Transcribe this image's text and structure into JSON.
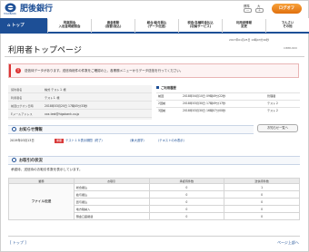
{
  "header": {
    "bank_name": "肥後銀行",
    "bank_sub": "HIGOBANK",
    "font_size_label": "標準",
    "font_size_large": "大",
    "logout_label": "ログオフ"
  },
  "nav": {
    "top": "トップ",
    "items": [
      {
        "line1": "残高照会",
        "line2": "入出金明細照会"
      },
      {
        "line1": "資金移動",
        "line2": "(振替/振込)"
      },
      {
        "line1": "総合/給与振込",
        "line2": "(データ伝送)"
      },
      {
        "line1": "税金/各種料金払込",
        "line2": "(収納サービス)"
      },
      {
        "line1": "利用者情報",
        "line2": "変更"
      },
      {
        "line1": "でんさい",
        "line2": "その他"
      }
    ]
  },
  "page": {
    "datetime": "2017年01月25日 19時03分26秒",
    "title": "利用者トップページ",
    "code": "CIBMU200"
  },
  "alert": {
    "icon": "!",
    "text": "送信待データがあります。送信待総件の件数をご確認の上、各業務メニューからデータ送信を行ってください。"
  },
  "user_info": [
    {
      "label": "契約者名",
      "value": "株式 テスト１ 様"
    },
    {
      "label": "利用者名",
      "value": "テスト１ 様"
    },
    {
      "label": "前回ログオン日時",
      "value": "2018年03月20日 17時45分33秒"
    },
    {
      "label": "Eメールアドレス",
      "value": "xxx-test@higobank.co.jp"
    }
  ],
  "history": {
    "title": "ご利用履歴",
    "rows": [
      {
        "when": "前回",
        "datetime": "2018年04月10日 09時49分22秒",
        "user": "管理者"
      },
      {
        "when": "2回前",
        "datetime": "2018年03月30日 17時49分17秒",
        "user": "テスト２"
      },
      {
        "when": "3回前",
        "datetime": "2018年03月30日 16時07分00秒",
        "user": "テスト２"
      }
    ]
  },
  "notices": {
    "title": "お知らせ情報",
    "list_button": "お知らせ一覧へ",
    "item": {
      "date": "2019年03月13日",
      "badge": "重要",
      "link1": "テスト１８表示期間（終了）",
      "link2": "（東大進学）",
      "link3": "（テキストのみ表示）"
    }
  },
  "transactions": {
    "title": "お取引の状況",
    "description": "承認待、送信待のお取引件数を表示しています。",
    "headers": [
      "業務",
      "お取引",
      "承認待件数",
      "送信待件数"
    ],
    "category": "ファイル伝送",
    "rows": [
      {
        "name": "総合振込",
        "approval": "0",
        "send": "1"
      },
      {
        "name": "給与振込",
        "approval": "0",
        "send": "0"
      },
      {
        "name": "賞与振込",
        "approval": "0",
        "send": "0"
      },
      {
        "name": "地方税納入",
        "approval": "0",
        "send": "0"
      },
      {
        "name": "預金口座振替",
        "approval": "0",
        "send": "0"
      }
    ]
  },
  "footer": {
    "top_link": "[ トップ ]",
    "page_top": "ページ上部へ"
  },
  "colors": {
    "brand": "#1d4f96",
    "accent": "#e0700e",
    "alert": "#d33333"
  }
}
